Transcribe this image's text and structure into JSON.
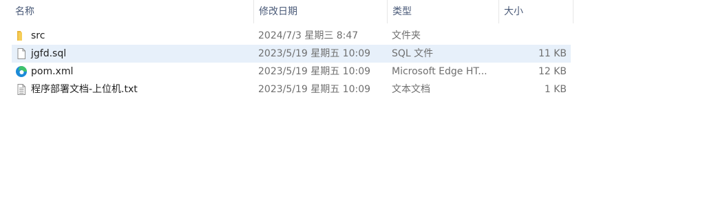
{
  "header": {
    "name": "名称",
    "date": "修改日期",
    "type": "类型",
    "size": "大小",
    "sort_indicator": "^"
  },
  "rows": [
    {
      "name": "src",
      "date": "2024/7/3 星期三 8:47",
      "type": "文件夹",
      "size": "",
      "icon": "folder-icon",
      "selected": false
    },
    {
      "name": "jgfd.sql",
      "date": "2023/5/19 星期五 10:09",
      "type": "SQL 文件",
      "size": "11 KB",
      "icon": "file-icon",
      "selected": true
    },
    {
      "name": "pom.xml",
      "date": "2023/5/19 星期五 10:09",
      "type": "Microsoft Edge HT...",
      "size": "12 KB",
      "icon": "edge-icon",
      "selected": false
    },
    {
      "name": "程序部署文档-上位机.txt",
      "date": "2023/5/19 星期五 10:09",
      "type": "文本文档",
      "size": "1 KB",
      "icon": "text-file-icon",
      "selected": false
    }
  ],
  "colors": {
    "selected_row": "#e7f0fa",
    "header_text": "#4a5a78",
    "folder": "#f4c542",
    "edge": "#1c8ad8"
  }
}
